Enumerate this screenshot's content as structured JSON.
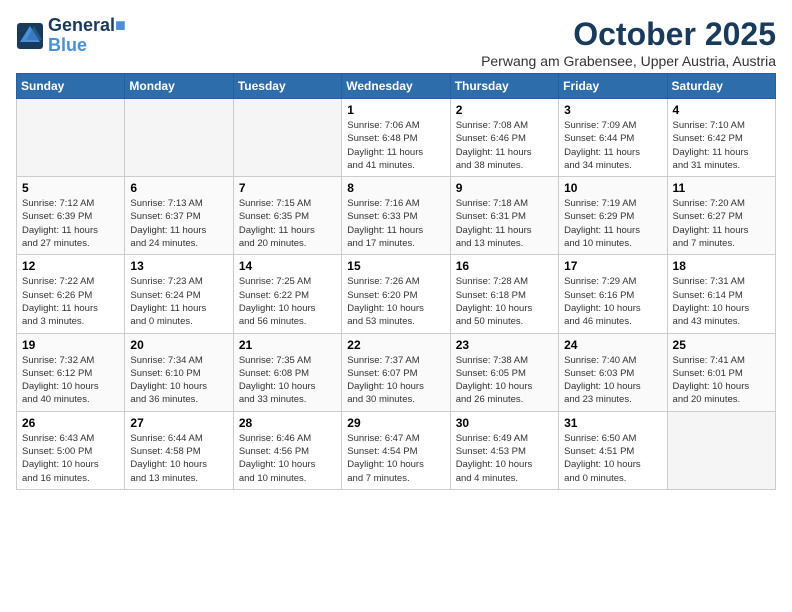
{
  "header": {
    "logo_line1": "General",
    "logo_line2": "Blue",
    "month": "October 2025",
    "location": "Perwang am Grabensee, Upper Austria, Austria"
  },
  "weekdays": [
    "Sunday",
    "Monday",
    "Tuesday",
    "Wednesday",
    "Thursday",
    "Friday",
    "Saturday"
  ],
  "weeks": [
    [
      {
        "day": "",
        "info": ""
      },
      {
        "day": "",
        "info": ""
      },
      {
        "day": "",
        "info": ""
      },
      {
        "day": "1",
        "info": "Sunrise: 7:06 AM\nSunset: 6:48 PM\nDaylight: 11 hours\nand 41 minutes."
      },
      {
        "day": "2",
        "info": "Sunrise: 7:08 AM\nSunset: 6:46 PM\nDaylight: 11 hours\nand 38 minutes."
      },
      {
        "day": "3",
        "info": "Sunrise: 7:09 AM\nSunset: 6:44 PM\nDaylight: 11 hours\nand 34 minutes."
      },
      {
        "day": "4",
        "info": "Sunrise: 7:10 AM\nSunset: 6:42 PM\nDaylight: 11 hours\nand 31 minutes."
      }
    ],
    [
      {
        "day": "5",
        "info": "Sunrise: 7:12 AM\nSunset: 6:39 PM\nDaylight: 11 hours\nand 27 minutes."
      },
      {
        "day": "6",
        "info": "Sunrise: 7:13 AM\nSunset: 6:37 PM\nDaylight: 11 hours\nand 24 minutes."
      },
      {
        "day": "7",
        "info": "Sunrise: 7:15 AM\nSunset: 6:35 PM\nDaylight: 11 hours\nand 20 minutes."
      },
      {
        "day": "8",
        "info": "Sunrise: 7:16 AM\nSunset: 6:33 PM\nDaylight: 11 hours\nand 17 minutes."
      },
      {
        "day": "9",
        "info": "Sunrise: 7:18 AM\nSunset: 6:31 PM\nDaylight: 11 hours\nand 13 minutes."
      },
      {
        "day": "10",
        "info": "Sunrise: 7:19 AM\nSunset: 6:29 PM\nDaylight: 11 hours\nand 10 minutes."
      },
      {
        "day": "11",
        "info": "Sunrise: 7:20 AM\nSunset: 6:27 PM\nDaylight: 11 hours\nand 7 minutes."
      }
    ],
    [
      {
        "day": "12",
        "info": "Sunrise: 7:22 AM\nSunset: 6:26 PM\nDaylight: 11 hours\nand 3 minutes."
      },
      {
        "day": "13",
        "info": "Sunrise: 7:23 AM\nSunset: 6:24 PM\nDaylight: 11 hours\nand 0 minutes."
      },
      {
        "day": "14",
        "info": "Sunrise: 7:25 AM\nSunset: 6:22 PM\nDaylight: 10 hours\nand 56 minutes."
      },
      {
        "day": "15",
        "info": "Sunrise: 7:26 AM\nSunset: 6:20 PM\nDaylight: 10 hours\nand 53 minutes."
      },
      {
        "day": "16",
        "info": "Sunrise: 7:28 AM\nSunset: 6:18 PM\nDaylight: 10 hours\nand 50 minutes."
      },
      {
        "day": "17",
        "info": "Sunrise: 7:29 AM\nSunset: 6:16 PM\nDaylight: 10 hours\nand 46 minutes."
      },
      {
        "day": "18",
        "info": "Sunrise: 7:31 AM\nSunset: 6:14 PM\nDaylight: 10 hours\nand 43 minutes."
      }
    ],
    [
      {
        "day": "19",
        "info": "Sunrise: 7:32 AM\nSunset: 6:12 PM\nDaylight: 10 hours\nand 40 minutes."
      },
      {
        "day": "20",
        "info": "Sunrise: 7:34 AM\nSunset: 6:10 PM\nDaylight: 10 hours\nand 36 minutes."
      },
      {
        "day": "21",
        "info": "Sunrise: 7:35 AM\nSunset: 6:08 PM\nDaylight: 10 hours\nand 33 minutes."
      },
      {
        "day": "22",
        "info": "Sunrise: 7:37 AM\nSunset: 6:07 PM\nDaylight: 10 hours\nand 30 minutes."
      },
      {
        "day": "23",
        "info": "Sunrise: 7:38 AM\nSunset: 6:05 PM\nDaylight: 10 hours\nand 26 minutes."
      },
      {
        "day": "24",
        "info": "Sunrise: 7:40 AM\nSunset: 6:03 PM\nDaylight: 10 hours\nand 23 minutes."
      },
      {
        "day": "25",
        "info": "Sunrise: 7:41 AM\nSunset: 6:01 PM\nDaylight: 10 hours\nand 20 minutes."
      }
    ],
    [
      {
        "day": "26",
        "info": "Sunrise: 6:43 AM\nSunset: 5:00 PM\nDaylight: 10 hours\nand 16 minutes."
      },
      {
        "day": "27",
        "info": "Sunrise: 6:44 AM\nSunset: 4:58 PM\nDaylight: 10 hours\nand 13 minutes."
      },
      {
        "day": "28",
        "info": "Sunrise: 6:46 AM\nSunset: 4:56 PM\nDaylight: 10 hours\nand 10 minutes."
      },
      {
        "day": "29",
        "info": "Sunrise: 6:47 AM\nSunset: 4:54 PM\nDaylight: 10 hours\nand 7 minutes."
      },
      {
        "day": "30",
        "info": "Sunrise: 6:49 AM\nSunset: 4:53 PM\nDaylight: 10 hours\nand 4 minutes."
      },
      {
        "day": "31",
        "info": "Sunrise: 6:50 AM\nSunset: 4:51 PM\nDaylight: 10 hours\nand 0 minutes."
      },
      {
        "day": "",
        "info": ""
      }
    ]
  ]
}
